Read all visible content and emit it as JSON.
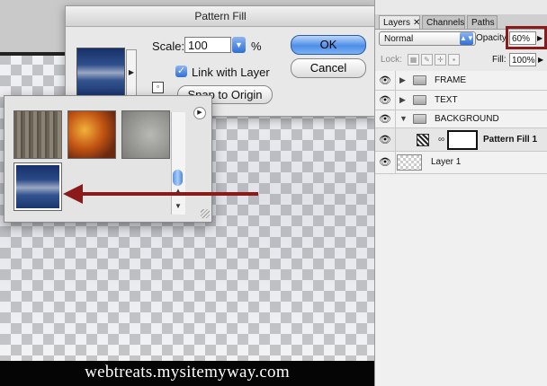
{
  "dialog": {
    "title": "Pattern Fill",
    "scale_label": "Scale:",
    "scale_value": "100",
    "scale_unit": "%",
    "link_with_layer_label": "Link with Layer",
    "link_with_layer_checked": true,
    "snap_to_origin_label": "Snap to Origin",
    "ok_label": "OK",
    "cancel_label": "Cancel"
  },
  "pattern_picker": {
    "patterns": [
      "wood-grain",
      "rusty-metal",
      "gray-stone",
      "blue-clouds"
    ],
    "selected": "blue-clouds"
  },
  "layers_panel": {
    "tabs": [
      {
        "label": "Layers",
        "active": true
      },
      {
        "label": "Channels",
        "active": false
      },
      {
        "label": "Paths",
        "active": false
      }
    ],
    "blend_mode": "Normal",
    "opacity_label": "Opacity:",
    "opacity_value": "60%",
    "lock_label": "Lock:",
    "fill_label": "Fill:",
    "fill_value": "100%",
    "layers": [
      {
        "name": "FRAME",
        "type": "group",
        "expanded": false
      },
      {
        "name": "TEXT",
        "type": "group",
        "expanded": false
      },
      {
        "name": "BACKGROUND",
        "type": "group",
        "expanded": true
      },
      {
        "name": "Pattern Fill 1",
        "type": "fill",
        "selected": true
      },
      {
        "name": "Layer 1",
        "type": "layer"
      }
    ]
  },
  "watermark": "webtreats.mysitemyway.com",
  "colors": {
    "highlight_box": "#8b1a1a",
    "arrow": "#8b1a1a",
    "button_accent": "#4e8ee8"
  }
}
